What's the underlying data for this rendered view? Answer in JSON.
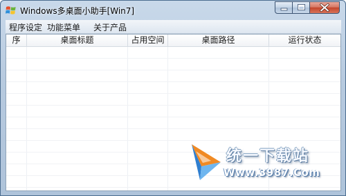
{
  "window": {
    "title": "Windows多桌面小助手[Win7]"
  },
  "menu": {
    "items": [
      "程序设定",
      "功能菜单",
      "关于产品"
    ]
  },
  "table": {
    "columns": [
      "序",
      "桌面标题",
      "占用空间",
      "桌面路径",
      "运行状态"
    ],
    "rows": []
  },
  "watermark": {
    "brand": "统一下载站",
    "url": "Www.3987.Com"
  },
  "icons": {
    "app": "windows-flag-icon",
    "minimize": "minimize-icon",
    "maximize": "maximize-icon",
    "close": "close-icon"
  }
}
